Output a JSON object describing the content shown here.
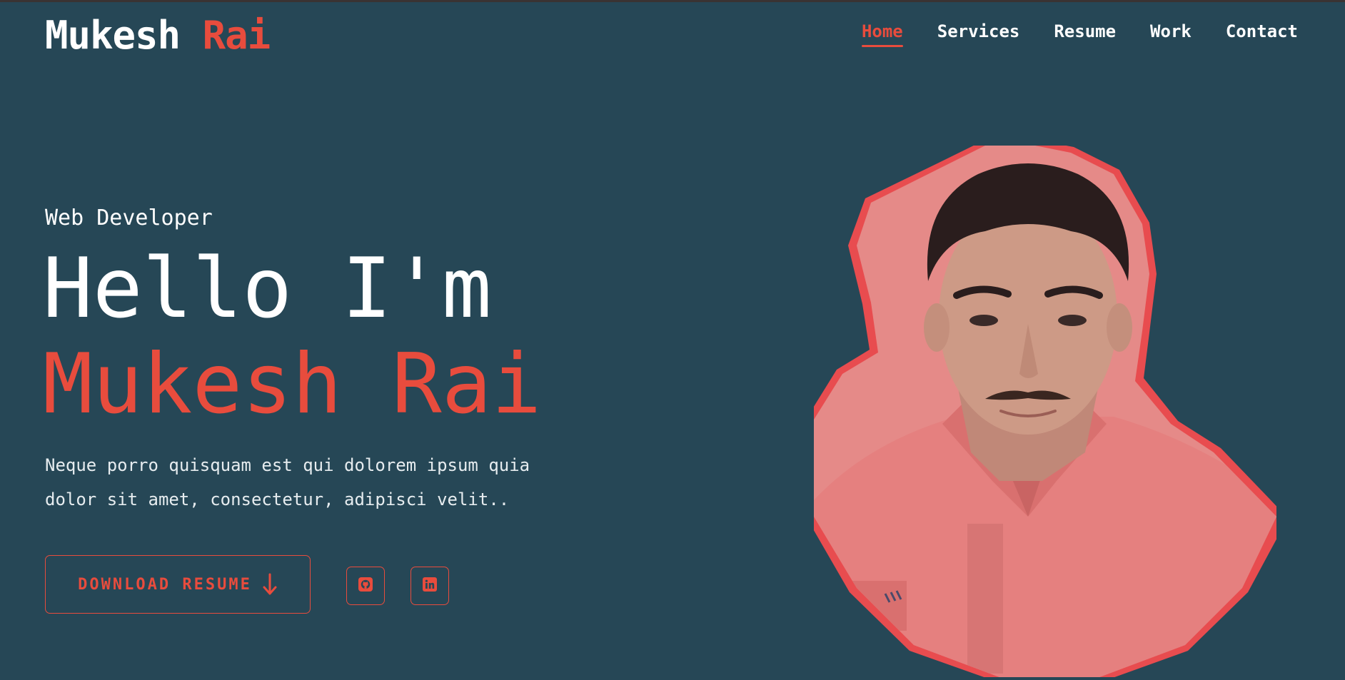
{
  "brand": {
    "first": "Mukesh",
    "last": "Rai"
  },
  "nav": {
    "items": [
      {
        "label": "Home",
        "active": true
      },
      {
        "label": "Services",
        "active": false
      },
      {
        "label": "Resume",
        "active": false
      },
      {
        "label": "Work",
        "active": false
      },
      {
        "label": "Contact",
        "active": false
      }
    ]
  },
  "hero": {
    "role": "Web Developer",
    "greeting": "Hello I'm",
    "name": "Mukesh Rai",
    "description": "Neque porro quisquam est qui dolorem ipsum quia dolor sit amet, consectetur, adipisci velit..",
    "download_label": "DOWNLOAD RESUME",
    "socials": [
      {
        "name": "github",
        "icon": "github-icon"
      },
      {
        "name": "linkedin",
        "icon": "linkedin-icon"
      }
    ]
  },
  "colors": {
    "background": "#264756",
    "accent": "#e84c3d",
    "text": "#ffffff"
  }
}
